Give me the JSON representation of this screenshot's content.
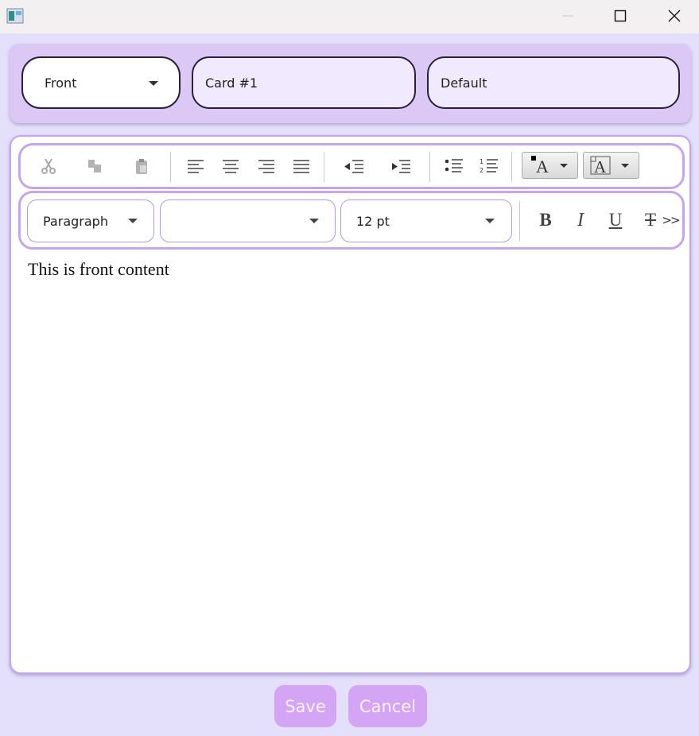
{
  "window": {
    "min_icon": "minimize-icon",
    "max_icon": "maximize-icon",
    "close_icon": "close-icon"
  },
  "header": {
    "side_selected": "Front",
    "card_title": "Card #1",
    "deck": "Default"
  },
  "toolbar1": {
    "icons": [
      "cut-icon",
      "copy-icon",
      "paste-icon",
      "align-left-icon",
      "align-center-icon",
      "align-right-icon",
      "align-justify-icon",
      "outdent-icon",
      "indent-icon",
      "bullet-list-icon",
      "numbered-list-icon",
      "font-color-icon",
      "highlight-color-icon"
    ]
  },
  "toolbar2": {
    "paragraph": "Paragraph",
    "font_family": "",
    "font_size": "12 pt",
    "bold_glyph": "B",
    "italic_glyph": "I",
    "underline_glyph": "U",
    "strike_glyph": "T",
    "more_glyph": ">>"
  },
  "editor": {
    "content": "This is front content"
  },
  "actions": {
    "save": "Save",
    "cancel": "Cancel"
  },
  "colors": {
    "accent": "#d4a5f4",
    "border": "#c4a5ee",
    "background": "#e4e0fb",
    "header": "#dbc8f4"
  }
}
